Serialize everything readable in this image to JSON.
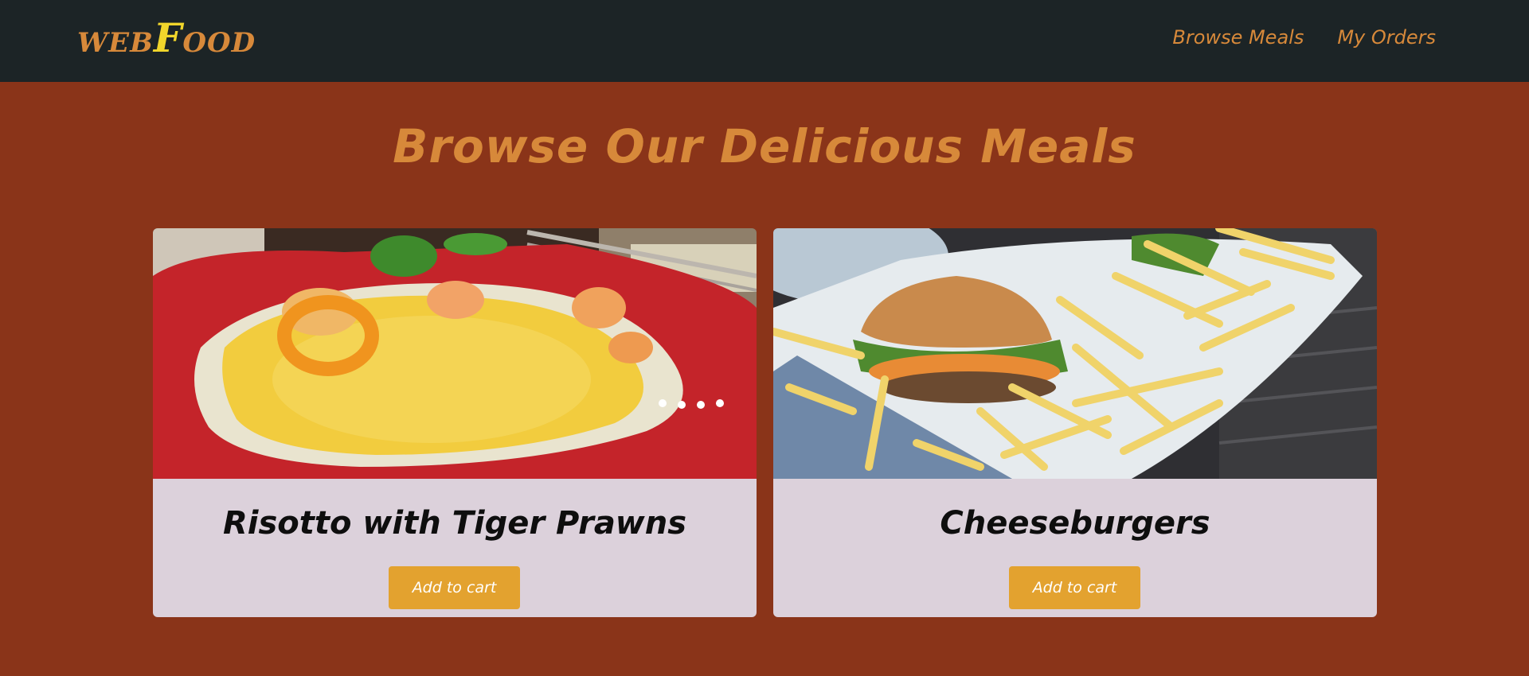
{
  "header": {
    "brand_small_1": "WEB",
    "brand_big": "F",
    "brand_small_2": "OOD",
    "nav": [
      {
        "label": "Browse Meals"
      },
      {
        "label": "My Orders"
      }
    ]
  },
  "main": {
    "title": "Browse Our Delicious Meals",
    "meals": [
      {
        "name": "Risotto with Tiger Prawns",
        "button_label": "Add to cart"
      },
      {
        "name": "Cheeseburgers",
        "button_label": "Add to cart"
      }
    ]
  },
  "colors": {
    "header_bg": "#1c2426",
    "page_bg": "#8a3419",
    "accent": "#d7893a",
    "logo_highlight": "#f1d62b",
    "card_bg": "#dcd1db",
    "button_bg": "#e3a22f"
  }
}
